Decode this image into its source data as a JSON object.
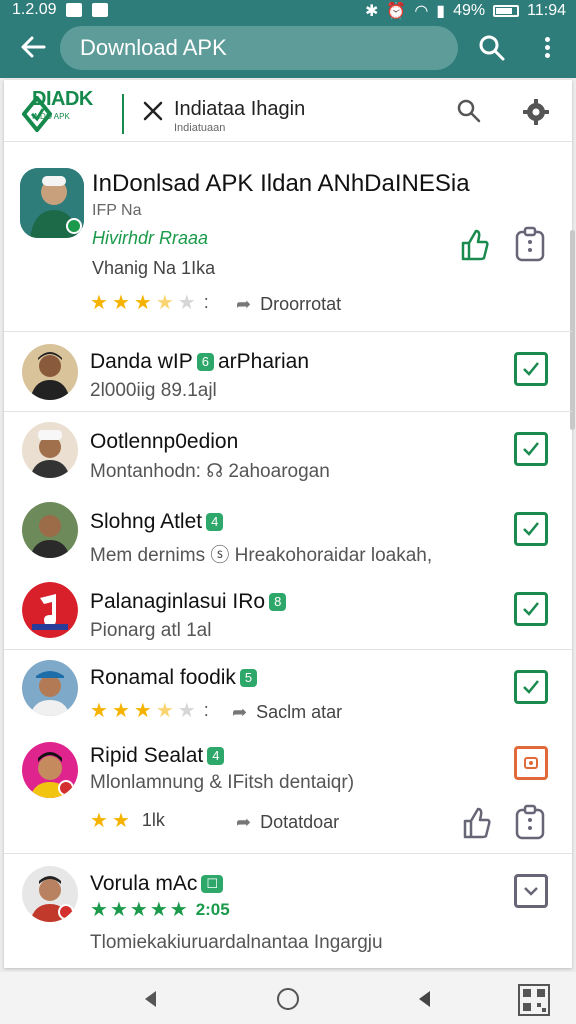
{
  "status_bar": {
    "time_left": "1.2.09",
    "battery": "49%",
    "time_right": "11:94"
  },
  "app_bar": {
    "search_text": "Download APK"
  },
  "brand": {
    "logo_text": "DIADK",
    "logo_caption": "INDO APK",
    "title": "Indiataa Ihagin",
    "caption": "Indiatuaan"
  },
  "featured": {
    "title": "InDonlsad APK Ildan ANhDaINESia",
    "subtitle": "IFP Na",
    "developer": "Hivirhdr Rraaa",
    "meta": "Vhanig Na 1Ika",
    "rating": {
      "stars": 3.5,
      "sep": ":"
    },
    "download_label": "Droorrotat"
  },
  "list": [
    {
      "name": "Danda wIP",
      "badge": "6",
      "name_suffix": "arPharian",
      "sub": "2l000iig 89.1ajl",
      "check": "green"
    },
    {
      "name": "Ootlennp0edion",
      "badge": "",
      "name_suffix": "",
      "sub": "Montanhodn: ☊ 2ahoarogan",
      "check": "green"
    },
    {
      "name": "Slohng Atlet",
      "badge": "4",
      "name_suffix": "",
      "sub": "Mem dernims ⓢ Hreakohoraidar loakah,",
      "check": "green"
    },
    {
      "name": "Palanaginlasui IRo",
      "badge": "8",
      "name_suffix": "",
      "sub": "Pionarg atl 1al",
      "check": "green"
    },
    {
      "name": "Ronamal foodik",
      "badge": "5",
      "name_suffix": "",
      "rating": {
        "stars": 3.5,
        "sep": ":"
      },
      "action": "Saclm atar",
      "check": "green"
    },
    {
      "name": "Ripid Sealat",
      "badge": "4",
      "name_suffix": "",
      "sub": "Mlonlamnung & IFitsh dentaiqr)",
      "rating": {
        "stars": 2,
        "count": "1lk"
      },
      "action": "Dotatdoar",
      "check": "orange"
    },
    {
      "name": "Vorula mAc",
      "badge": "☐",
      "name_suffix": "",
      "rating": {
        "stars": 5,
        "count": "2:05"
      },
      "sub": "Tlomiekakiuruardalnantaa Ingargju",
      "check": "grey"
    }
  ],
  "colors": {
    "brand_teal": "#2f7d7b",
    "accent_green": "#1a8a4f",
    "star_yellow": "#f5b300",
    "alert_orange": "#e06a3a"
  },
  "icons": [
    "back-arrow-icon",
    "search-icon",
    "more-vert-icon",
    "close-icon",
    "gear-icon",
    "thumb-up-icon",
    "bookmark-icon",
    "checkbox-icon",
    "share-arrow-icon",
    "nav-back-icon",
    "nav-home-icon",
    "nav-recents-icon",
    "qr-icon"
  ]
}
